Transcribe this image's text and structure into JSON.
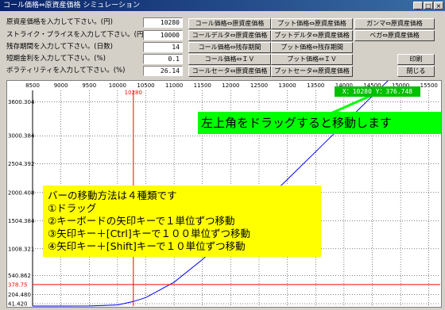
{
  "window": {
    "title": "コール価格⇔原資産価格 シミュレーション",
    "minimize": "_",
    "maximize": "□",
    "close": "×"
  },
  "inputs": [
    {
      "label": "原資産価格を入力して下さい。(円)",
      "value": "10280"
    },
    {
      "label": "ストライク・プライスを入力して下さい。(円)",
      "value": "10000"
    },
    {
      "label": "残存期間を入力して下さい。(日数)",
      "value": "14"
    },
    {
      "label": "短期金利を入力して下さい。(%)",
      "value": "0.1"
    },
    {
      "label": "ボラティリティを入力して下さい。(%)",
      "value": "26.14"
    }
  ],
  "buttons": {
    "call_underlying": "コール価格⇔原資産価格",
    "put_underlying": "プット価格⇔原資産価格",
    "gamma_underlying": "ガンマ⇔原資産価格",
    "calldelta_underlying": "コールデルタ⇔原資産価格",
    "putdelta_underlying": "プットデルタ⇔原資産価格",
    "vega_underlying": "ベガ⇔原資産価格",
    "call_remaining": "コール価格⇔残存期間",
    "put_remaining": "プット価格⇔残存期間",
    "call_iv": "コール価格⇔ＩＶ",
    "put_iv": "プット価格⇔ＩＶ",
    "calltheta_underlying": "コールセータ⇔原資産価格",
    "puttheta_underlying": "プットセータ⇔原資産価格",
    "print": "印刷",
    "close": "閉じる"
  },
  "chart_data": {
    "type": "line",
    "x_ticks": [
      "8500",
      "9000",
      "9500",
      "10000",
      "10500",
      "11000",
      "11500",
      "12000",
      "12500",
      "13000",
      "13500",
      "14000",
      "14500",
      "15000",
      "15500"
    ],
    "y_ticks": [
      "41.420",
      "204.480",
      "540.862",
      "1008.321",
      "1504.384",
      "2000.408",
      "2504.392",
      "3000.384",
      "3600.304"
    ],
    "xlim": [
      8500,
      15700
    ],
    "ylim": [
      0,
      3800
    ],
    "x_marker": {
      "value": 10280,
      "label": "10280"
    },
    "y_marker": {
      "value": 378.75,
      "label": "378.75"
    },
    "series": [
      {
        "points": [
          [
            8500,
            0
          ],
          [
            9000,
            0.1
          ],
          [
            9500,
            1.5
          ],
          [
            10000,
            20
          ],
          [
            10280,
            80
          ],
          [
            10500,
            150
          ],
          [
            11000,
            420
          ],
          [
            11500,
            820
          ],
          [
            12000,
            1280
          ],
          [
            12500,
            1750
          ],
          [
            13000,
            2230
          ],
          [
            13500,
            2720
          ],
          [
            14000,
            3210
          ],
          [
            14500,
            3700
          ],
          [
            15000,
            4190
          ],
          [
            15500,
            4680
          ]
        ]
      }
    ]
  },
  "overlay": {
    "coord": "X：10280 Y：376.748",
    "drag_hint": "左上角をドラッグすると移動します",
    "help": [
      "バーの移動方法は４種類です",
      "①ドラッグ",
      "②キーボードの矢印キーで１単位ずつ移動",
      "③矢印キー＋[Ctrl]キーで１００単位ずつ移動",
      "④矢印キー＋[Shift]キーで１０単位ずつ移動"
    ]
  },
  "colors": {
    "curve": "#0000ff",
    "marker": "#ff0000",
    "help_bg": "#ffff00",
    "drag_bg": "#00ff00",
    "coord_bg": "#00c000"
  }
}
